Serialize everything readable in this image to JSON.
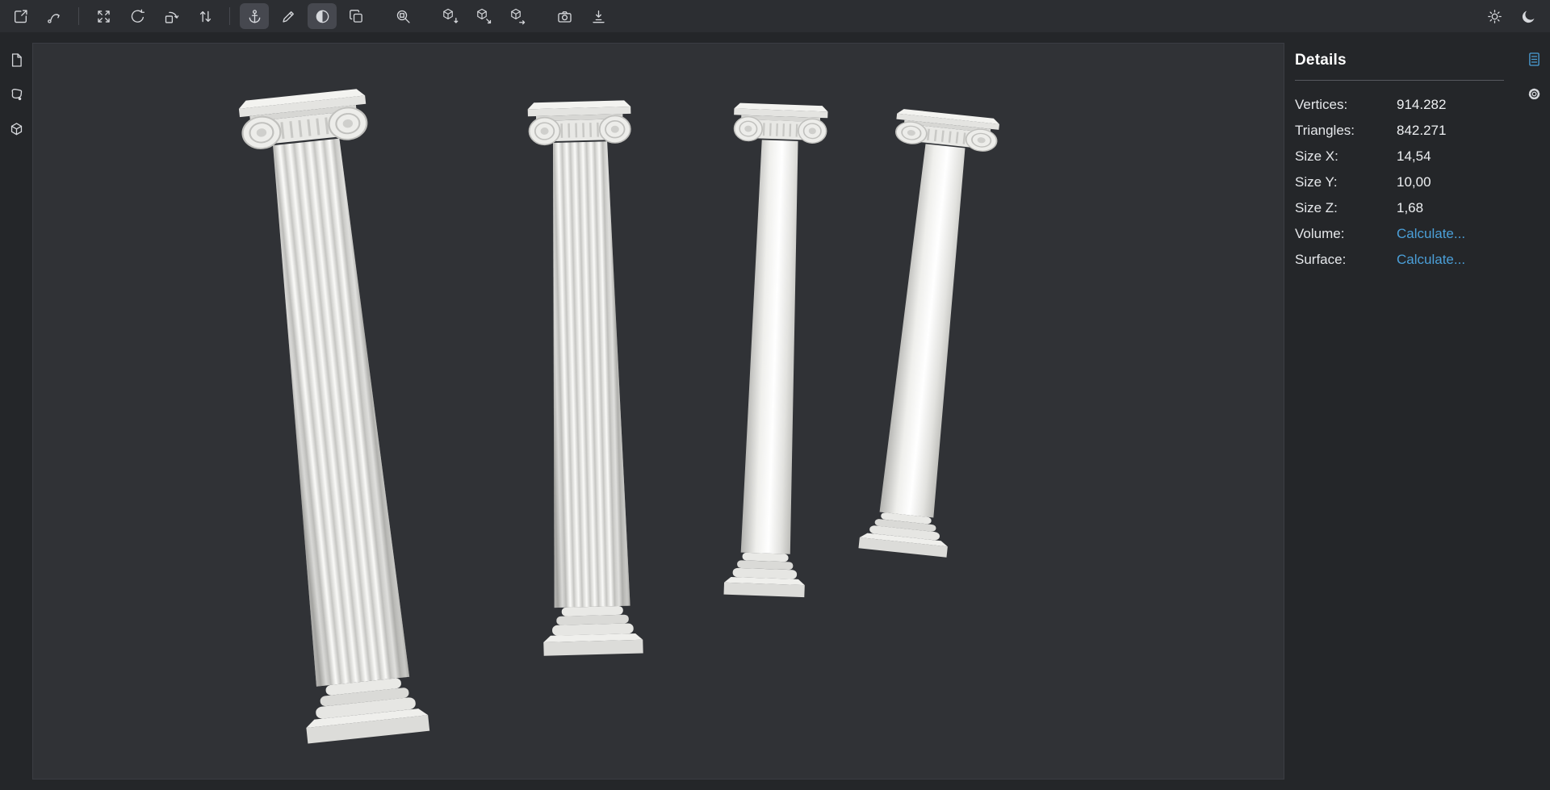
{
  "app": {
    "name": "3D mesh viewer",
    "theme": {
      "background": "#242629",
      "toolbar_background": "#2c2e32",
      "canvas_background": "#303236",
      "active_button_background": "#46484f",
      "icon_color": "#d6d8dc",
      "text_color": "#e9ebee",
      "accent": "#4b9fd8"
    }
  },
  "toolbar": {
    "buttons": [
      {
        "name": "open-scene",
        "icon": "open-scene-icon",
        "active": false
      },
      {
        "name": "curve-path",
        "icon": "curve-arrow-icon",
        "active": false
      },
      {
        "name": "fit-view",
        "icon": "fit-view-icon",
        "active": false
      },
      {
        "name": "rotate-view",
        "icon": "rotate-view-icon",
        "active": false
      },
      {
        "name": "rotate-plane",
        "icon": "rotate-plane-icon",
        "active": false
      },
      {
        "name": "swap-axes",
        "icon": "swap-vertical-icon",
        "active": false
      },
      {
        "name": "pivot",
        "icon": "pivot-anchor-icon",
        "active": true
      },
      {
        "name": "draw-line",
        "icon": "pen-icon",
        "active": false
      },
      {
        "name": "clip-plane",
        "icon": "half-sphere-icon",
        "active": true
      },
      {
        "name": "copy",
        "icon": "copy-icon",
        "active": false
      },
      {
        "name": "zoom-region",
        "icon": "zoom-box-icon",
        "active": false
      },
      {
        "name": "object-import",
        "icon": "cube-arrow-down-icon",
        "active": false
      },
      {
        "name": "object-export",
        "icon": "cube-arrow-out-icon",
        "active": false
      },
      {
        "name": "object-transfer",
        "icon": "cube-arrow-right-icon",
        "active": false
      },
      {
        "name": "screenshot",
        "icon": "camera-icon",
        "active": false
      },
      {
        "name": "drop-to-floor",
        "icon": "align-floor-icon",
        "active": false
      }
    ],
    "right_buttons": [
      {
        "name": "light-theme",
        "icon": "sun-icon"
      },
      {
        "name": "dark-theme",
        "icon": "moon-icon"
      }
    ]
  },
  "left_sidebar": {
    "buttons": [
      {
        "name": "files-panel",
        "icon": "file-icon"
      },
      {
        "name": "edit-panel",
        "icon": "shape-edit-icon"
      },
      {
        "name": "objects-panel",
        "icon": "cube-icon"
      }
    ]
  },
  "right_strip": {
    "buttons": [
      {
        "name": "details-panel",
        "icon": "document-lines-icon",
        "active": true
      },
      {
        "name": "settings",
        "icon": "gear-icon",
        "active": false
      }
    ]
  },
  "details": {
    "title": "Details",
    "rows": [
      {
        "label": "Vertices:",
        "value": "914.282"
      },
      {
        "label": "Triangles:",
        "value": "842.271"
      },
      {
        "label": "Size X:",
        "value": "14,54"
      },
      {
        "label": "Size Y:",
        "value": "10,00"
      },
      {
        "label": "Size Z:",
        "value": "1,68"
      },
      {
        "label": "Volume:",
        "value": "Calculate...",
        "link": true
      },
      {
        "label": "Surface:",
        "value": "Calculate...",
        "link": true
      }
    ]
  },
  "scene": {
    "description": "Four white classical columns standing on a dark viewport, fanned in perspective",
    "objects": [
      {
        "name": "ionic-column-fluted-large"
      },
      {
        "name": "ionic-column-fluted"
      },
      {
        "name": "column-smooth"
      },
      {
        "name": "column-smooth-small"
      }
    ]
  }
}
